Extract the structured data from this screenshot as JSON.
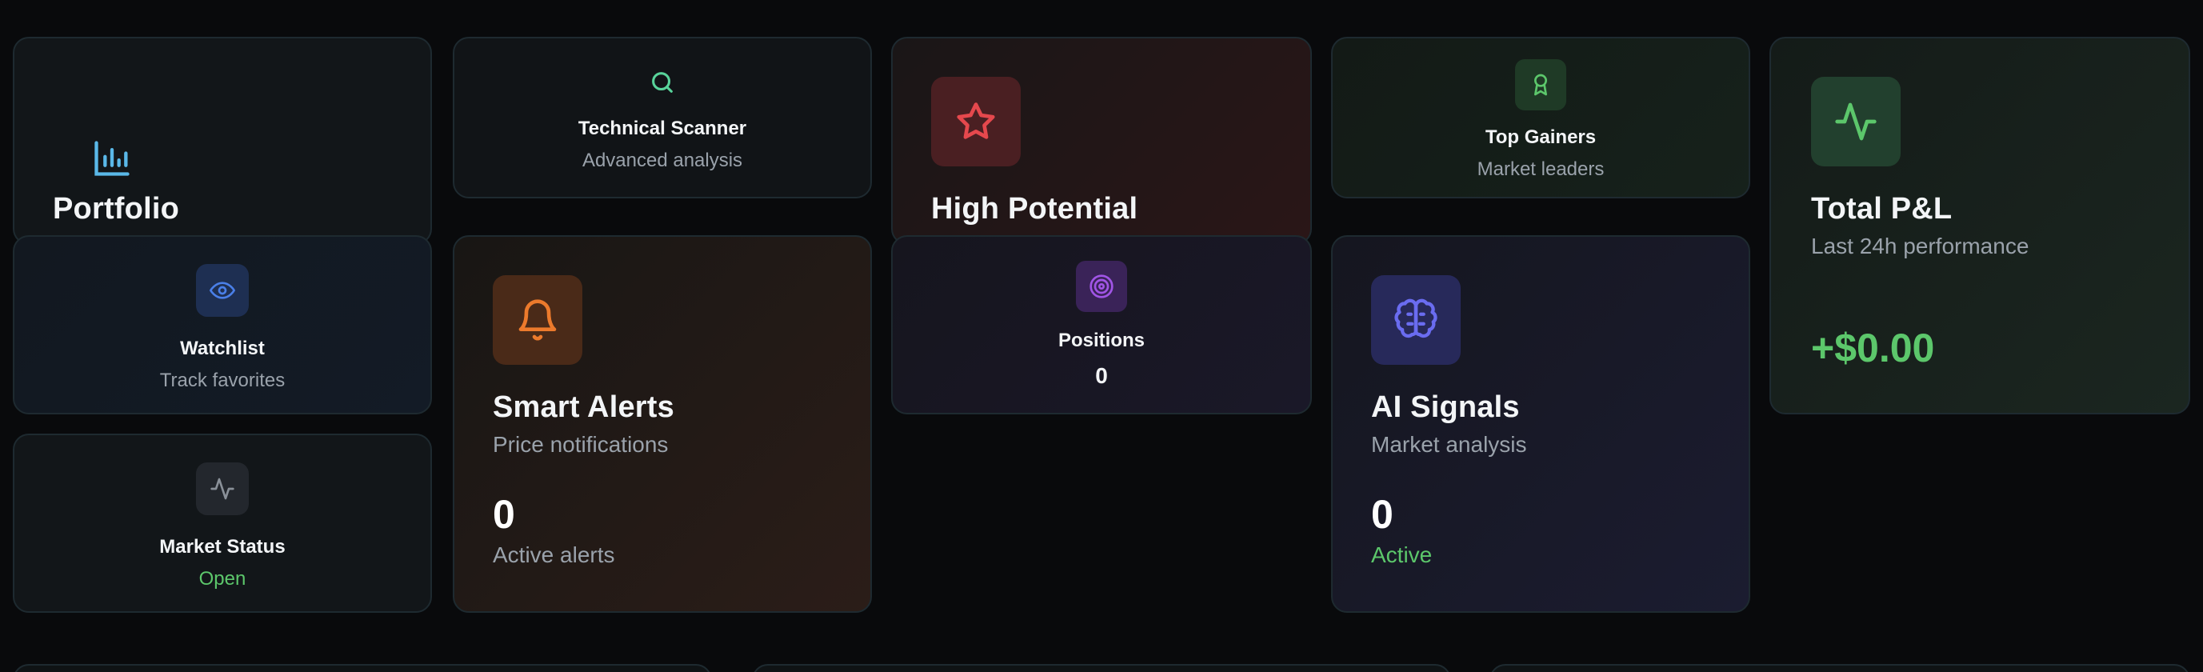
{
  "cards": {
    "portfolio": {
      "title": "Portfolio",
      "icon": "bar-chart-icon",
      "color": "#5ab8e8"
    },
    "technical_scanner": {
      "title": "Technical Scanner",
      "subtitle": "Advanced analysis",
      "icon": "search-icon",
      "color": "#58d39a"
    },
    "high_potential": {
      "title": "High Potential",
      "icon": "star-icon",
      "color": "#e5484d"
    },
    "top_gainers": {
      "title": "Top Gainers",
      "subtitle": "Market leaders",
      "icon": "award-icon",
      "color": "#5cc76b"
    },
    "total_pnl": {
      "title": "Total P&L",
      "subtitle": "Last 24h performance",
      "value": "+$0.00",
      "icon": "activity-icon",
      "color": "#5cc76b"
    },
    "watchlist": {
      "title": "Watchlist",
      "subtitle": "Track favorites",
      "icon": "eye-icon",
      "color": "#4a7fe8"
    },
    "smart_alerts": {
      "title": "Smart Alerts",
      "subtitle": "Price notifications",
      "value": "0",
      "value_label": "Active alerts",
      "icon": "bell-icon",
      "color": "#ec7a2c"
    },
    "positions": {
      "title": "Positions",
      "value": "0",
      "icon": "target-icon",
      "color": "#a155e6"
    },
    "ai_signals": {
      "title": "AI Signals",
      "subtitle": "Market analysis",
      "value": "0",
      "value_label": "Active",
      "icon": "brain-icon",
      "color": "#6a6cf0"
    },
    "market_status": {
      "title": "Market Status",
      "value": "Open",
      "icon": "activity-icon",
      "color": "#5cc76b"
    }
  }
}
